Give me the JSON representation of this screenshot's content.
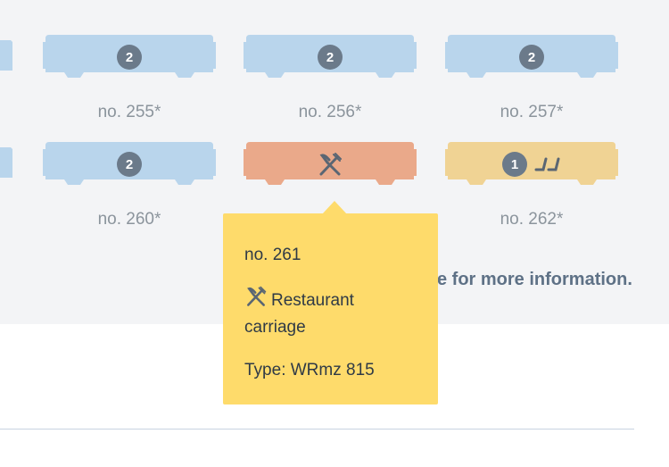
{
  "colors": {
    "standard_car": "#b9d5ec",
    "restaurant_car": "#eaa98a",
    "special_car": "#f0d394",
    "badge": "#6b7a8a",
    "tooltip": "#fedb6b"
  },
  "row1": [
    {
      "badge": "2",
      "label": "no. 255*"
    },
    {
      "badge": "2",
      "label": "no. 256*"
    },
    {
      "badge": "2",
      "label": "no. 257*"
    }
  ],
  "row2": [
    {
      "badge": "2",
      "label": "no. 260*"
    },
    {
      "icon": "fork-knife-icon",
      "label": "no. 261"
    },
    {
      "badge": "1",
      "icon": "seat-icon",
      "label": "no. 262*"
    }
  ],
  "info_text": "e for more information.",
  "tooltip": {
    "title": "no. 261",
    "feature_line1": "Restaurant",
    "feature_line2": "carriage",
    "feature_icon": "fork-knife-icon",
    "type": "Type: WRmz 815"
  }
}
